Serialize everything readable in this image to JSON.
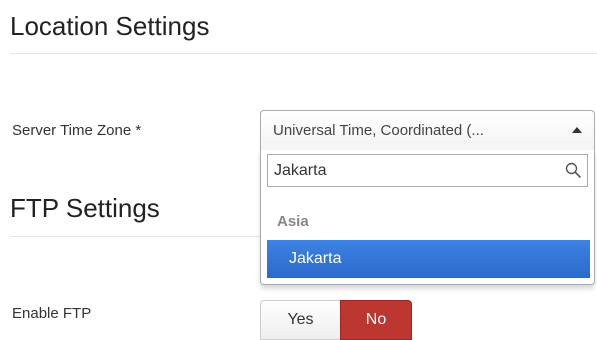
{
  "location_section": {
    "title": "Location Settings"
  },
  "server_time_zone": {
    "label": "Server Time Zone *",
    "selected_value": "Universal Time, Coordinated (...",
    "search_value": "Jakarta",
    "group_label": "Asia",
    "highlighted_option": "Jakarta"
  },
  "ftp_section": {
    "title": "FTP Settings"
  },
  "enable_ftp": {
    "label": "Enable FTP",
    "yes_label": "Yes",
    "no_label": "No",
    "selected": "No"
  },
  "colors": {
    "highlight": "#3875d7",
    "no_active": "#bd362f"
  },
  "icons": {
    "search": "search-icon",
    "caret": "caret-up-icon"
  }
}
